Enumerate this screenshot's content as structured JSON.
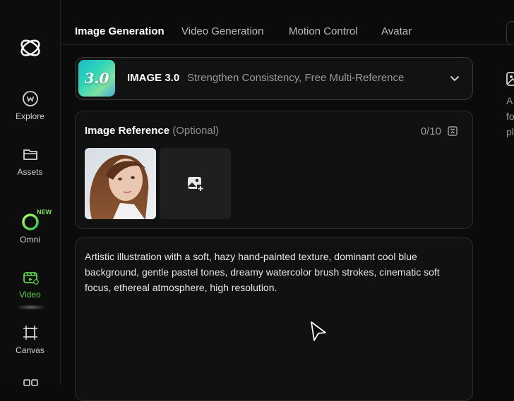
{
  "sidebar": {
    "items": [
      {
        "label": "Explore",
        "icon": "explore-icon"
      },
      {
        "label": "Assets",
        "icon": "folder-icon"
      },
      {
        "label": "Omni",
        "icon": "omni-icon",
        "badge": "NEW"
      },
      {
        "label": "Video",
        "icon": "video-icon",
        "active": true
      },
      {
        "label": "Canvas",
        "icon": "canvas-icon"
      }
    ]
  },
  "tabs": [
    {
      "label": "Image Generation",
      "active": true
    },
    {
      "label": "Video Generation"
    },
    {
      "label": "Motion Control"
    },
    {
      "label": "Avatar"
    }
  ],
  "model": {
    "thumb_text": "3.0",
    "name": "IMAGE 3.0",
    "description": "Strengthen Consistency, Free Multi-Reference"
  },
  "reference": {
    "title": "Image Reference",
    "optional": "(Optional)",
    "count": "0/10"
  },
  "prompt": {
    "text": "Artistic illustration with a soft, hazy hand-painted texture, dominant cool blue background, gentle pastel tones, dreamy watercolor brush strokes, cinematic soft focus, ethereal atmosphere, high resolution."
  },
  "right_panel": {
    "lines": [
      "A",
      "fo",
      "pl"
    ]
  },
  "colors": {
    "accent_green": "#5fd24a",
    "background": "#0b0b0c",
    "panel": "#111112"
  }
}
